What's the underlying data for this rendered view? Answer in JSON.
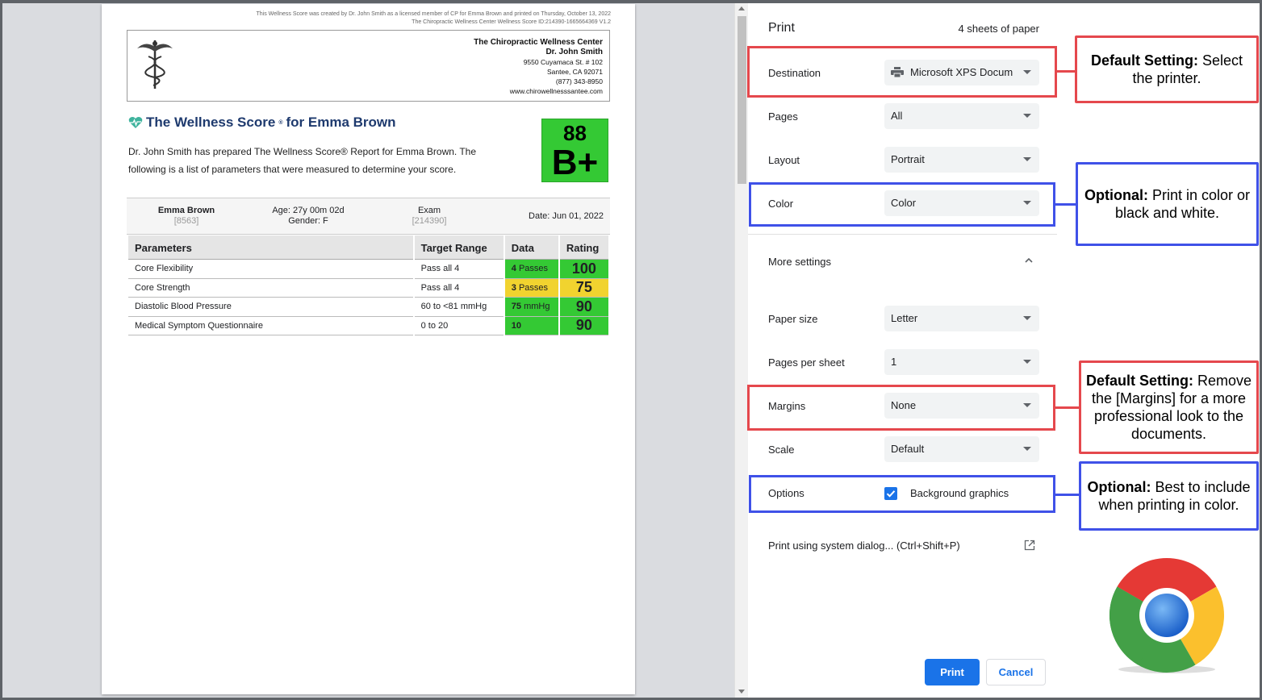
{
  "document": {
    "header_line1": "This Wellness Score was created by Dr. John Smith as a licensed member of CP for Emma Brown and printed on Thursday, October 13, 2022",
    "header_line2": "The Chiropractic Wellness Center Wellness Score ID:214390-1665664369 V1.2",
    "clinic": {
      "name": "The Chiropractic Wellness Center",
      "doctor": "Dr. John Smith",
      "address1": "9550 Cuyamaca St. # 102",
      "address2": "Santee, CA 92071",
      "phone": "(877) 343-8950",
      "website": "www.chirowellnesssantee.com"
    },
    "title_prefix": "The Wellness Score",
    "title_mark": "®",
    "title_suffix": " for Emma Brown",
    "description": "Dr. John Smith has prepared The Wellness Score® Report for Emma Brown. The following is a list of parameters that were measured to determine your score.",
    "score": {
      "number": "88",
      "grade": "B+",
      "color": "#34c934"
    },
    "patient": {
      "name": "Emma Brown",
      "id": "[8563]",
      "age": "Age: 27y 00m 02d",
      "gender": "Gender: F",
      "exam_label": "Exam",
      "exam_id": "[214390]",
      "date": "Date: Jun 01, 2022"
    },
    "table": {
      "headers": [
        "Parameters",
        "Target Range",
        "Data",
        "Rating"
      ],
      "rows": [
        {
          "parameter": "Core Flexibility",
          "target": "Pass all 4",
          "data_num": "4",
          "data_unit": " Passes",
          "rating": "100",
          "color": "green"
        },
        {
          "parameter": "Core Strength",
          "target": "Pass all 4",
          "data_num": "3",
          "data_unit": " Passes",
          "rating": "75",
          "color": "yellow"
        },
        {
          "parameter": "Diastolic Blood Pressure",
          "target": "60 to <81 mmHg",
          "data_num": "75",
          "data_unit": " mmHg",
          "rating": "90",
          "color": "green"
        },
        {
          "parameter": "Medical Symptom Questionnaire",
          "target": "0 to 20",
          "data_num": "10",
          "data_unit": "",
          "rating": "90",
          "color": "green"
        }
      ]
    }
  },
  "panel": {
    "title": "Print",
    "sheets": "4 sheets of paper",
    "destination_label": "Destination",
    "destination_value": "Microsoft XPS Docum",
    "pages_label": "Pages",
    "pages_value": "All",
    "layout_label": "Layout",
    "layout_value": "Portrait",
    "color_label": "Color",
    "color_value": "Color",
    "more_settings": "More settings",
    "paper_size_label": "Paper size",
    "paper_size_value": "Letter",
    "pages_per_sheet_label": "Pages per sheet",
    "pages_per_sheet_value": "1",
    "margins_label": "Margins",
    "margins_value": "None",
    "scale_label": "Scale",
    "scale_value": "Default",
    "options_label": "Options",
    "background_graphics": "Background graphics",
    "background_graphics_checked": true,
    "system_dialog": "Print using system dialog... (Ctrl+Shift+P)",
    "print_button": "Print",
    "cancel_button": "Cancel",
    "accent_color": "#1a73e8"
  },
  "callouts": {
    "destination": {
      "bold": "Default Setting:",
      "text": " Select the printer.",
      "color": "#e5484d"
    },
    "color": {
      "bold": "Optional:",
      "text": " Print in color or black and white.",
      "color": "#3f51e8"
    },
    "margins": {
      "bold": "Default Setting:",
      "text": " Remove the [Margins] for a more professional look to the documents.",
      "color": "#e5484d"
    },
    "options": {
      "bold": "Optional:",
      "text": " Best to include when printing in color.",
      "color": "#3f51e8"
    }
  }
}
